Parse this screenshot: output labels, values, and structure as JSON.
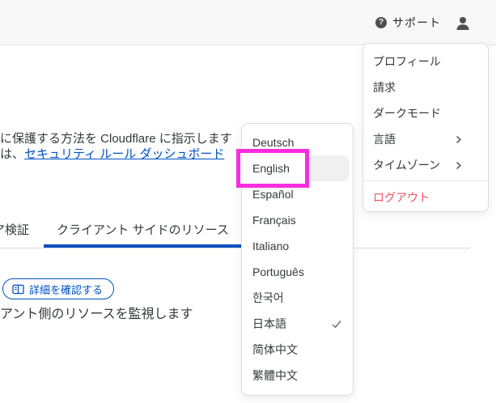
{
  "header": {
    "support_label": "サポート"
  },
  "icons": {
    "help_glyph": "?"
  },
  "content": {
    "intro_line1": "に保護する方法を Cloudflare に指示します",
    "intro_line2_prefix": "は、",
    "intro_line2_link": "セキュリティ ルール ダッシュボード",
    "tabs": [
      {
        "label": "ア検証",
        "active": false
      },
      {
        "label": "クライアント サイドのリソース",
        "active": true
      }
    ],
    "details_button_label": "詳細を確認する",
    "caption": "アント側のリソースを監視します"
  },
  "user_menu": {
    "items": [
      {
        "label": "プロフィール",
        "has_submenu": false
      },
      {
        "label": "請求",
        "has_submenu": false
      },
      {
        "label": "ダークモード",
        "has_submenu": false
      },
      {
        "label": "言語",
        "has_submenu": true
      },
      {
        "label": "タイムゾーン",
        "has_submenu": true
      }
    ],
    "logout_label": "ログアウト"
  },
  "language_menu": {
    "items": [
      {
        "label": "Deutsch"
      },
      {
        "label": "English"
      },
      {
        "label": "Español"
      },
      {
        "label": "Français"
      },
      {
        "label": "Italiano"
      },
      {
        "label": "Português"
      },
      {
        "label": "한국어"
      },
      {
        "label": "日本語"
      },
      {
        "label": "简体中文"
      },
      {
        "label": "繁體中文"
      }
    ],
    "selected_language": "日本語",
    "highlighted_language": "English"
  },
  "annotation": {
    "type": "highlight-box",
    "target": "English",
    "color": "#f92ce0"
  },
  "colors": {
    "accent_blue": "#0051c3",
    "logout_red": "#f0505d",
    "highlight_magenta": "#f92ce0",
    "header_bg": "#f8f8f8"
  }
}
